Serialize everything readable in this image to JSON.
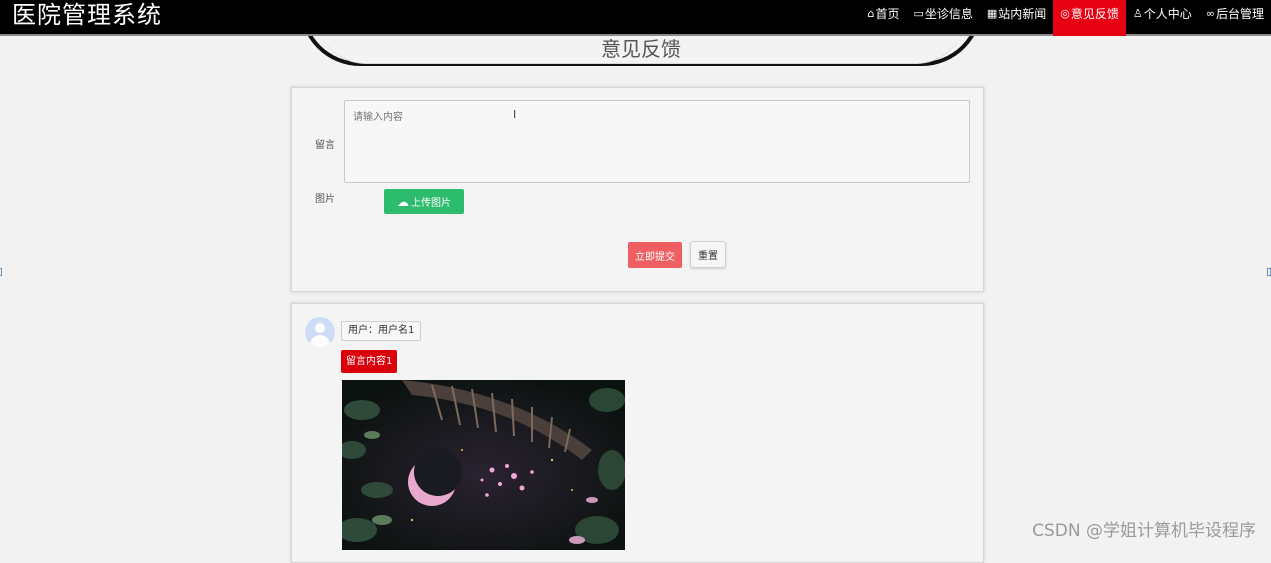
{
  "app": {
    "title": "医院管理系统"
  },
  "nav": {
    "items": [
      {
        "icon": "home-icon",
        "glyph": "⌂",
        "label": "首页",
        "active": false
      },
      {
        "icon": "book-icon",
        "glyph": "▭",
        "label": "坐诊信息",
        "active": false
      },
      {
        "icon": "news-icon",
        "glyph": "▦",
        "label": "站内新闻",
        "active": false
      },
      {
        "icon": "feedback-icon",
        "glyph": "◎",
        "label": "意见反馈",
        "active": true
      },
      {
        "icon": "user-icon",
        "glyph": "♙",
        "label": "个人中心",
        "active": false
      },
      {
        "icon": "link-icon",
        "glyph": "∞",
        "label": "后台管理",
        "active": false
      }
    ],
    "active_color": "#e60012"
  },
  "banner": {
    "title": "意见反馈"
  },
  "form": {
    "message_label": "留言",
    "message_placeholder": "请输入内容",
    "image_label": "图片",
    "upload_label": "上传图片",
    "submit_label": "立即提交",
    "reset_label": "重置",
    "upload_color": "#2dbc6e",
    "submit_color": "#ef5f61"
  },
  "comments": [
    {
      "user": "用户：用户名1",
      "content": "留言内容1"
    }
  ],
  "watermark": "CSDN @学姐计算机毕设程序"
}
